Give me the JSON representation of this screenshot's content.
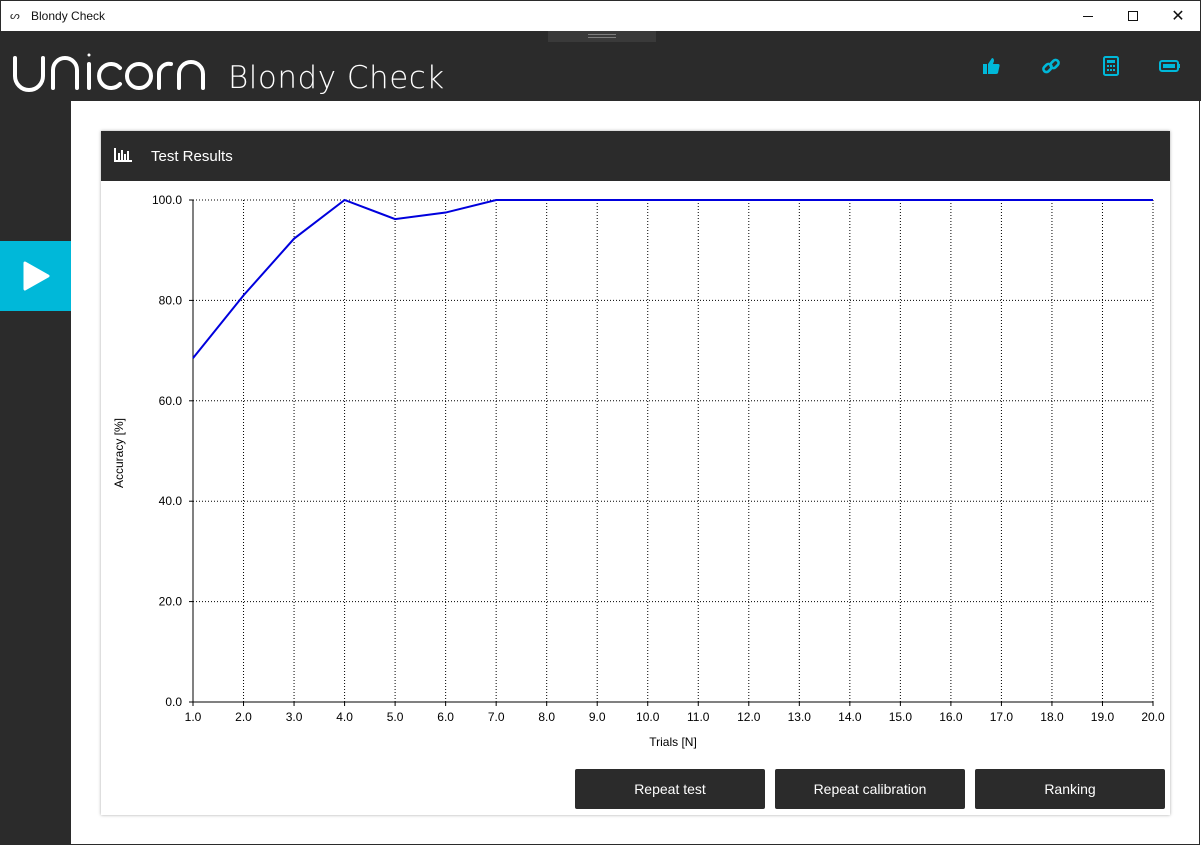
{
  "window": {
    "title": "Blondy Check",
    "app_icon": "unicorn-u-icon"
  },
  "header": {
    "brand": "unicorn",
    "app_name": "Blondy Check",
    "icons": [
      "thumbs-up-icon",
      "link-icon",
      "calculator-icon",
      "battery-icon"
    ],
    "accent_color": "#00b8d9"
  },
  "sidebar": {
    "active_item_icon": "play-icon"
  },
  "card": {
    "title": "Test Results",
    "icon": "bar-chart-icon"
  },
  "chart_data": {
    "type": "line",
    "title": "",
    "xlabel": "Trials [N]",
    "ylabel": "Accuracy [%]",
    "x": [
      1.0,
      2.0,
      3.0,
      4.0,
      5.0,
      6.0,
      7.0,
      8.0,
      9.0,
      10.0,
      11.0,
      12.0,
      13.0,
      14.0,
      15.0,
      16.0,
      17.0,
      18.0,
      19.0,
      20.0
    ],
    "series": [
      {
        "values": [
          68.5,
          81.0,
          92.3,
          100.0,
          96.2,
          97.5,
          100.0,
          100.0,
          100.0,
          100.0,
          100.0,
          100.0,
          100.0,
          100.0,
          100.0,
          100.0,
          100.0,
          100.0,
          100.0,
          100.0
        ],
        "color": "#0000dd"
      }
    ],
    "xlim": [
      1.0,
      20.0
    ],
    "ylim": [
      0.0,
      100.0
    ],
    "x_ticks": [
      "1.0",
      "2.0",
      "3.0",
      "4.0",
      "5.0",
      "6.0",
      "7.0",
      "8.0",
      "9.0",
      "10.0",
      "11.0",
      "12.0",
      "13.0",
      "14.0",
      "15.0",
      "16.0",
      "17.0",
      "18.0",
      "19.0",
      "20.0"
    ],
    "y_ticks": [
      "0.0",
      "20.0",
      "40.0",
      "60.0",
      "80.0",
      "100.0"
    ],
    "grid": true
  },
  "buttons": {
    "repeat_test": "Repeat test",
    "repeat_calibration": "Repeat calibration",
    "ranking": "Ranking"
  }
}
